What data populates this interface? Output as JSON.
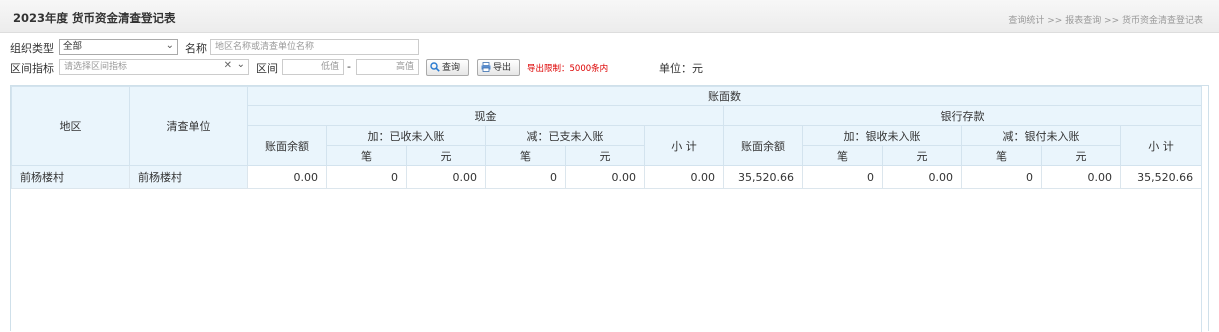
{
  "header": {
    "title": "2023年度 货币资金清查登记表",
    "breadcrumb": "查询统计 >> 报表查询 >> 货币资金清查登记表"
  },
  "filters": {
    "org_type_label": "组织类型",
    "org_type_value": "全部",
    "name_label": "名称",
    "name_placeholder": "地区名称或清查单位名称",
    "range_indicator_label": "区间指标",
    "range_indicator_placeholder": "请选择区间指标",
    "range_label": "区间",
    "low_placeholder": "低值",
    "dash": "-",
    "high_placeholder": "高值",
    "search_button": "查询",
    "export_button": "导出",
    "export_limit": "导出限制：5000条内",
    "unit": "单位：元"
  },
  "table": {
    "headers": {
      "region": "地区",
      "unit": "清查单位",
      "book_total": "账面数",
      "cash": "现金",
      "bank": "银行存款",
      "book_balance": "账面余额",
      "add_unrecorded_received": "加：已收未入账",
      "sub_unrecorded_paid": "减：已支未入账",
      "subtotal": "小 计",
      "add_bank_received": "加：银收未入账",
      "sub_bank_paid": "减：银付未入账",
      "count": "笔",
      "yuan": "元"
    },
    "rows": [
      {
        "region": "前杨楼村",
        "unit": "前杨楼村",
        "cash_balance": "0.00",
        "cash_add_count": "0",
        "cash_add_amount": "0.00",
        "cash_sub_count": "0",
        "cash_sub_amount": "0.00",
        "cash_subtotal": "0.00",
        "bank_balance": "35,520.66",
        "bank_add_count": "0",
        "bank_add_amount": "0.00",
        "bank_sub_count": "0",
        "bank_sub_amount": "0.00",
        "bank_subtotal": "35,520.66"
      }
    ]
  }
}
